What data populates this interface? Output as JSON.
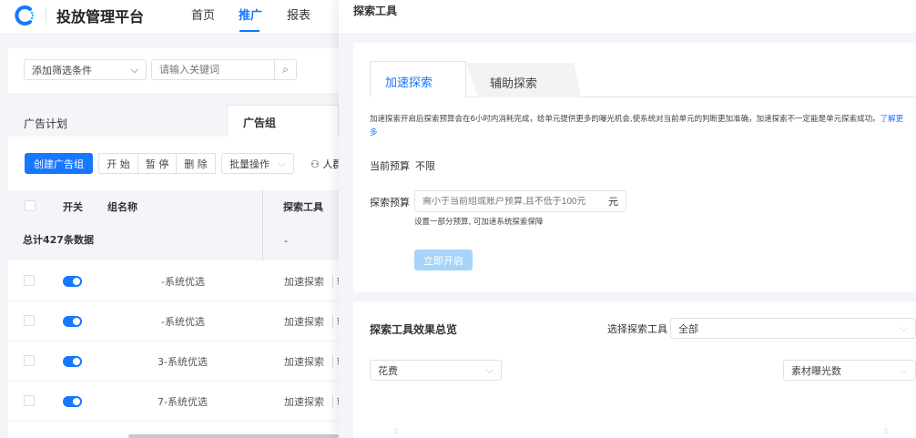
{
  "header": {
    "brand": "投放管理平台",
    "nav": [
      "首页",
      "推广",
      "报表"
    ]
  },
  "filter": {
    "add_filter": "添加筛选条件",
    "search_placeholder": "请输入关键词"
  },
  "tabs": [
    "广告计划",
    "广告组"
  ],
  "toolbar": {
    "create": "创建广告组",
    "start": "开 始",
    "pause": "暂 停",
    "delete": "删 除",
    "batch": "批量操作",
    "people": "人群"
  },
  "table": {
    "headers": [
      "开关",
      "组名称",
      "探索工具"
    ],
    "total": "总计427条数据",
    "total_tool": "-",
    "rows": [
      {
        "name": "-系统优选",
        "tool": "加速探索",
        "tool2": "辅"
      },
      {
        "name": "-系统优选",
        "tool": "加速探索",
        "tool2": "辅"
      },
      {
        "name": "3-系统优选",
        "tool": "加速探索",
        "tool2": "辅"
      },
      {
        "name": "7-系统优选",
        "tool": "加速探索",
        "tool2": "辅"
      }
    ]
  },
  "drawer": {
    "title": "探索工具",
    "tabs": [
      "加速探索",
      "辅助探索"
    ],
    "desc": "加速探索开启后探索预算会在6小时内消耗完成，给单元提供更多的曝光机会,使系统对当前单元的判断更加准确，加速探索不一定能是单元探索成功。",
    "learn_more": "了解更多",
    "current_budget_label": "当前预算",
    "current_budget_value": "不限",
    "budget_label": "探索预算",
    "budget_placeholder": "需小于当前组或账户预算,且不低于100元",
    "budget_unit": "元",
    "budget_hint": "设置一部分预算, 可加速系统探索保障",
    "start_button": "立即开启",
    "overview_title": "探索工具效果总览",
    "tool_select_label": "选择探索工具",
    "tool_select_value": "全部",
    "metric_left": "花费",
    "metric_right": "素材曝光数",
    "axis_left": "3",
    "axis_right": "3"
  }
}
